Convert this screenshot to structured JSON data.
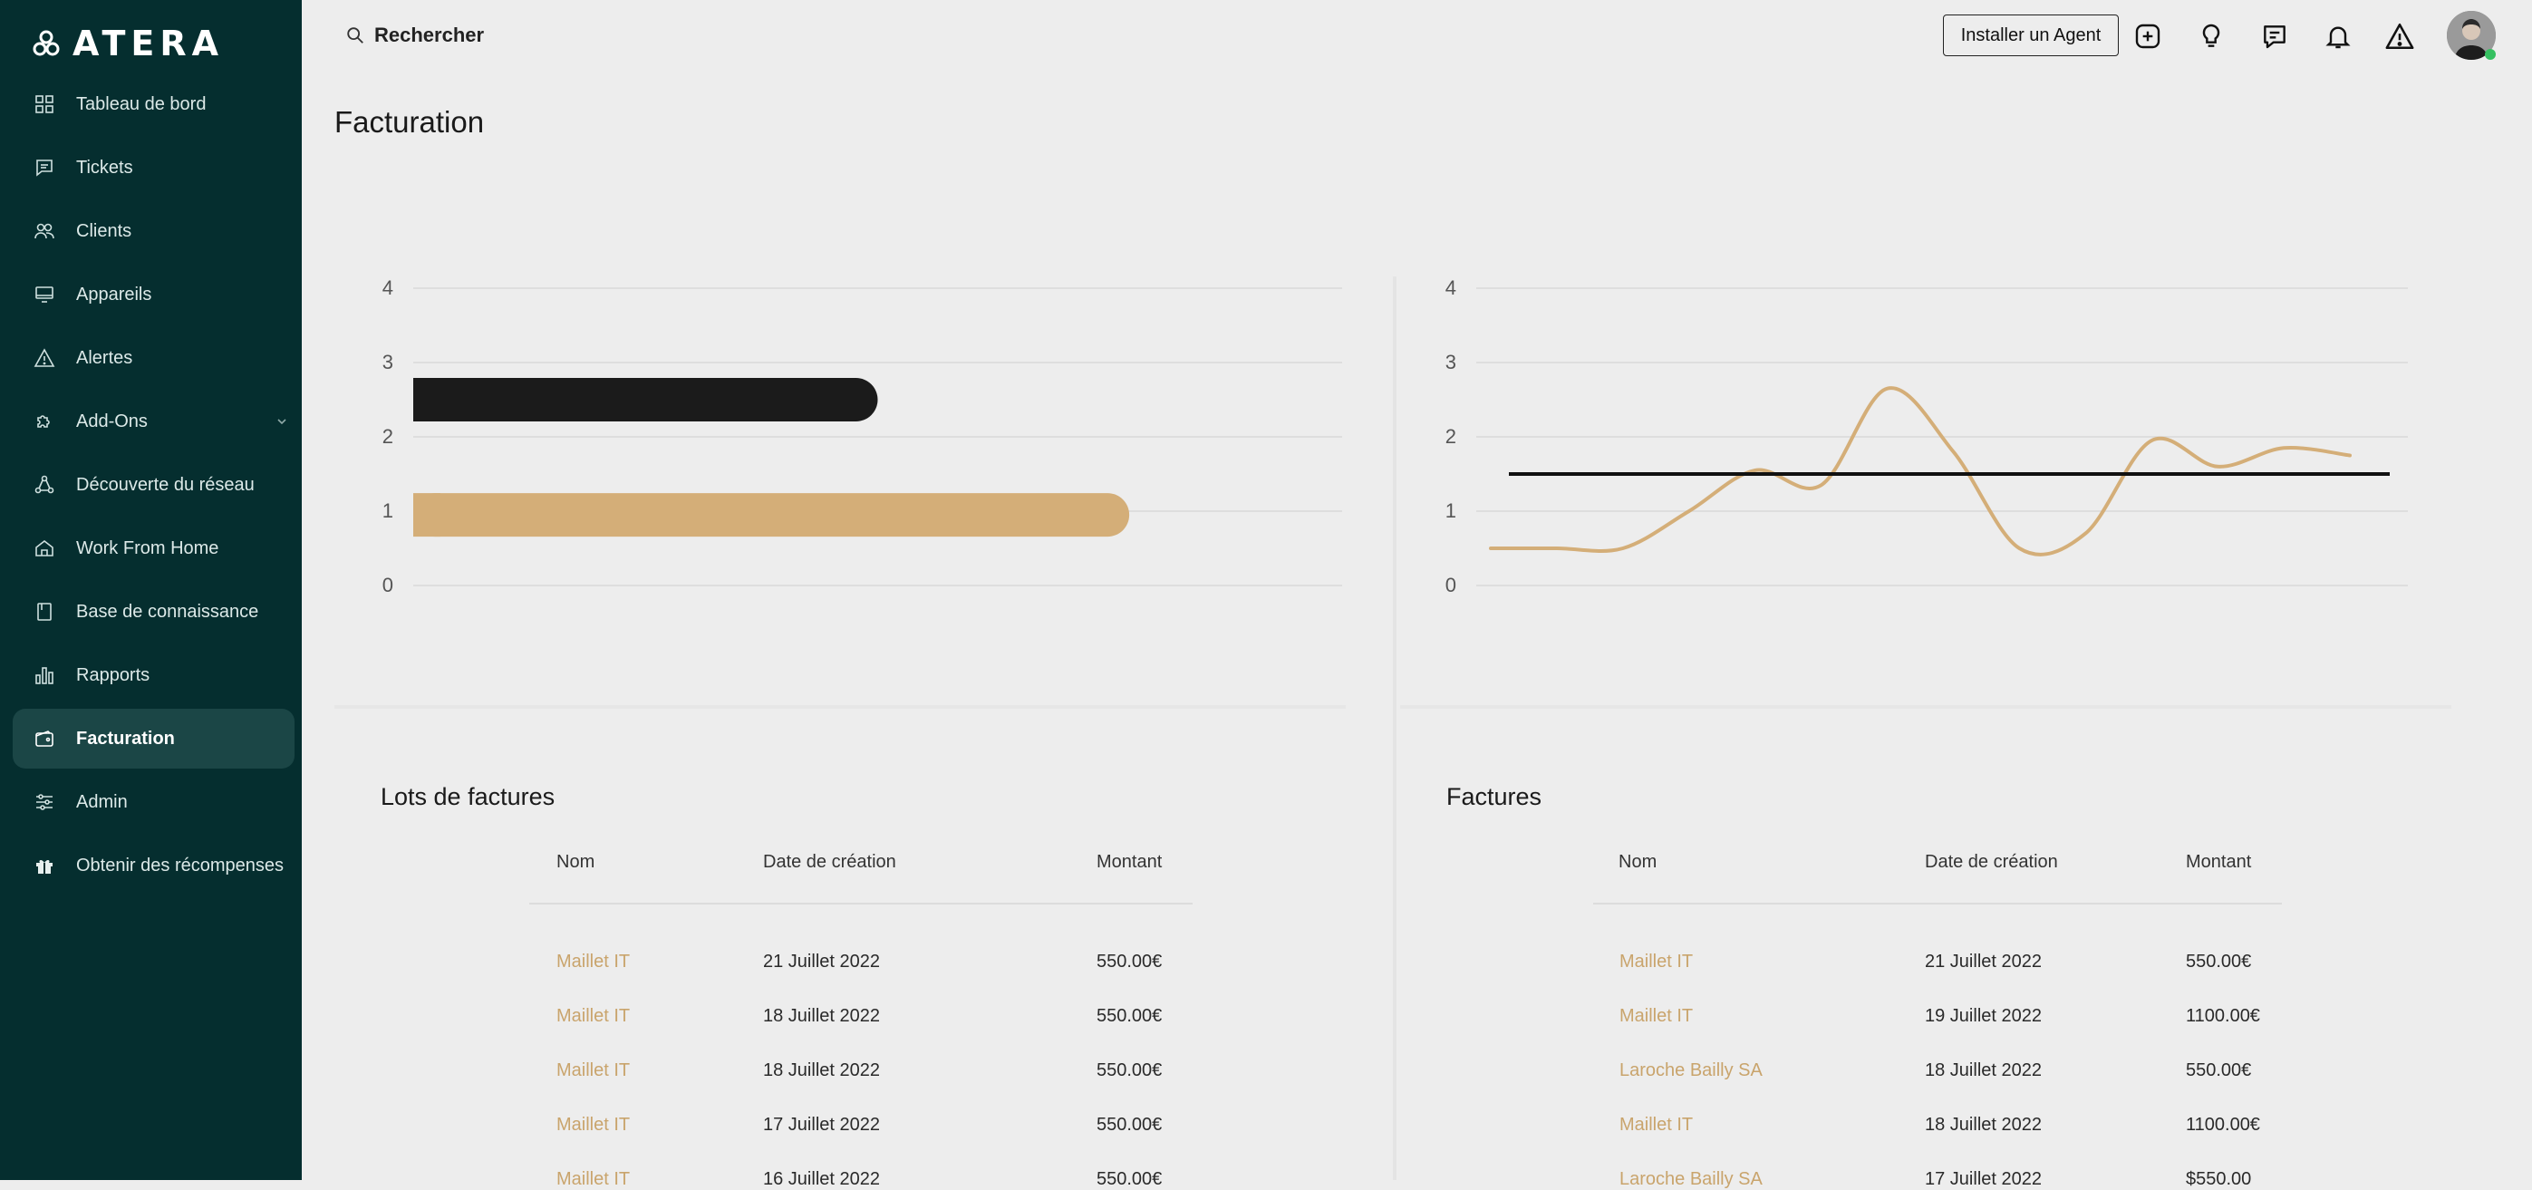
{
  "app": {
    "brand": "ATERA"
  },
  "sidebar": {
    "items": [
      {
        "label": "Tableau de bord",
        "icon": "dashboard-icon"
      },
      {
        "label": "Tickets",
        "icon": "ticket-icon"
      },
      {
        "label": "Clients",
        "icon": "users-icon"
      },
      {
        "label": "Appareils",
        "icon": "monitor-icon"
      },
      {
        "label": "Alertes",
        "icon": "alert-icon"
      },
      {
        "label": "Add-Ons",
        "icon": "puzzle-icon"
      },
      {
        "label": "Découverte du réseau",
        "icon": "network-icon"
      },
      {
        "label": "Work From Home",
        "icon": "home-icon"
      },
      {
        "label": "Base de connaissance",
        "icon": "book-icon"
      },
      {
        "label": "Rapports",
        "icon": "bar-chart-icon"
      },
      {
        "label": "Facturation",
        "icon": "wallet-icon"
      },
      {
        "label": "Admin",
        "icon": "sliders-icon"
      },
      {
        "label": "Obtenir des récompenses",
        "icon": "gift-icon"
      }
    ]
  },
  "header": {
    "search_label": "Rechercher",
    "install_label": "Installer un Agent"
  },
  "page": {
    "title": "Facturation"
  },
  "charts": {
    "bar": {
      "type": "bar",
      "orientation": "horizontal",
      "yticks": [
        "4",
        "3",
        "2",
        "1",
        "0"
      ],
      "ylim": [
        0,
        4
      ],
      "xlim": [
        0,
        2.4
      ],
      "bars": [
        {
          "value": 1.2,
          "position": 2.5,
          "color": "#1b1b1b"
        },
        {
          "value": 1.85,
          "position": 0.95,
          "color": "#d4ae78"
        }
      ]
    },
    "line": {
      "type": "line",
      "yticks": [
        "4",
        "3",
        "2",
        "1",
        "0"
      ],
      "ylim": [
        0,
        4
      ],
      "series": [
        {
          "color": "#d4ae78",
          "values": [
            0.5,
            0.5,
            0.5,
            1.0,
            1.55,
            1.35,
            2.65,
            1.8,
            0.5,
            0.7,
            1.95,
            1.6,
            1.85,
            1.75
          ]
        },
        {
          "color": "#111111",
          "values": [
            1.5,
            1.5
          ]
        }
      ]
    }
  },
  "lots": {
    "title": "Lots de factures",
    "headers": [
      "Nom",
      "Date de création",
      "Montant"
    ],
    "rows": [
      [
        "Maillet IT",
        "21 Juillet 2022",
        "550.00€"
      ],
      [
        "Maillet IT",
        "18 Juillet 2022",
        "550.00€"
      ],
      [
        "Maillet IT",
        "18 Juillet 2022",
        "550.00€"
      ],
      [
        "Maillet IT",
        "17 Juillet 2022",
        "550.00€"
      ],
      [
        "Maillet IT",
        "16 Juillet 2022",
        "550.00€"
      ]
    ]
  },
  "factures": {
    "title": "Factures",
    "headers": [
      "Nom",
      "Date de création",
      "Montant"
    ],
    "rows": [
      [
        "Maillet IT",
        "21 Juillet 2022",
        "550.00€"
      ],
      [
        "Maillet IT",
        "19 Juillet 2022",
        "1100.00€"
      ],
      [
        "Laroche Bailly SA",
        "18 Juillet 2022",
        "550.00€"
      ],
      [
        "Maillet IT",
        "18 Juillet 2022",
        "1100.00€"
      ],
      [
        "Laroche Bailly SA",
        "17 Juillet 2022",
        "$550.00"
      ]
    ]
  }
}
